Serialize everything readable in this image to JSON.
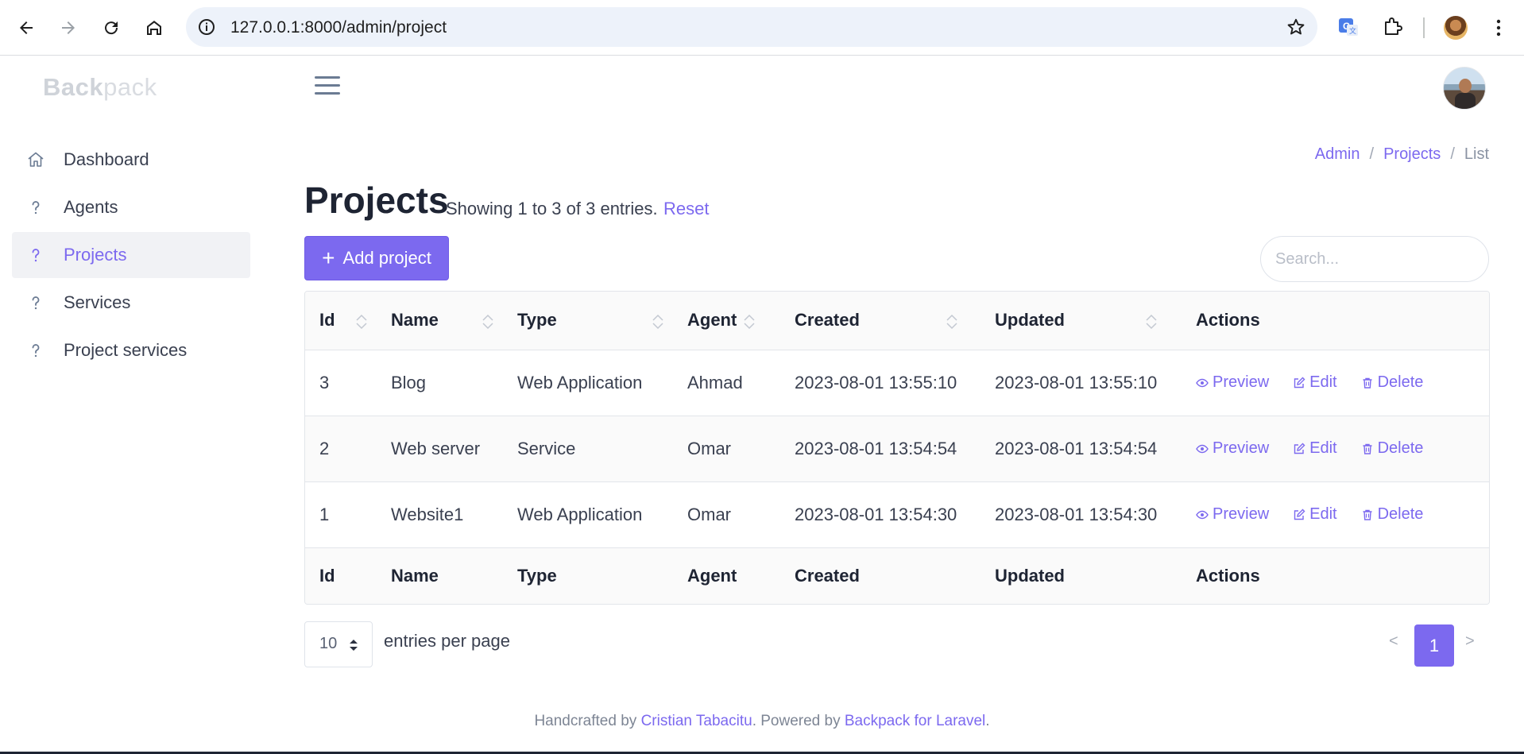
{
  "browser": {
    "url": "127.0.0.1:8000/admin/project"
  },
  "app": {
    "logo_bold": "Back",
    "logo_light": "pack"
  },
  "sidebar": {
    "items": [
      {
        "label": "Dashboard",
        "icon": "home-icon",
        "active": false
      },
      {
        "label": "Agents",
        "icon": "question-icon",
        "active": false
      },
      {
        "label": "Projects",
        "icon": "question-icon",
        "active": true
      },
      {
        "label": "Services",
        "icon": "question-icon",
        "active": false
      },
      {
        "label": "Project services",
        "icon": "question-icon",
        "active": false
      }
    ]
  },
  "breadcrumb": {
    "items": [
      "Admin",
      "Projects",
      "List"
    ],
    "separator": "/"
  },
  "header": {
    "title": "Projects",
    "subtitle": "Showing 1 to 3 of 3 entries.",
    "reset_label": "Reset",
    "add_label": "Add project",
    "search_placeholder": "Search..."
  },
  "table": {
    "columns": [
      "Id",
      "Name",
      "Type",
      "Agent",
      "Created",
      "Updated",
      "Actions"
    ],
    "rows": [
      {
        "id": "3",
        "name": "Blog",
        "type": "Web Application",
        "agent": "Ahmad",
        "created": "2023-08-01 13:55:10",
        "updated": "2023-08-01 13:55:10"
      },
      {
        "id": "2",
        "name": "Web server",
        "type": "Service",
        "agent": "Omar",
        "created": "2023-08-01 13:54:54",
        "updated": "2023-08-01 13:54:54"
      },
      {
        "id": "1",
        "name": "Website1",
        "type": "Web Application",
        "agent": "Omar",
        "created": "2023-08-01 13:54:30",
        "updated": "2023-08-01 13:54:30"
      }
    ],
    "actions": {
      "preview": "Preview",
      "edit": "Edit",
      "delete": "Delete"
    }
  },
  "pagination": {
    "per_page": "10",
    "per_page_label": "entries per page",
    "prev": "<",
    "current": "1",
    "next": ">"
  },
  "footer": {
    "prefix": "Handcrafted by ",
    "author": "Cristian Tabacitu",
    "middle": ". Powered by ",
    "product": "Backpack for Laravel",
    "suffix": "."
  },
  "colors": {
    "accent": "#7c69ef",
    "text": "#1e2433",
    "muted": "#7d8594"
  }
}
